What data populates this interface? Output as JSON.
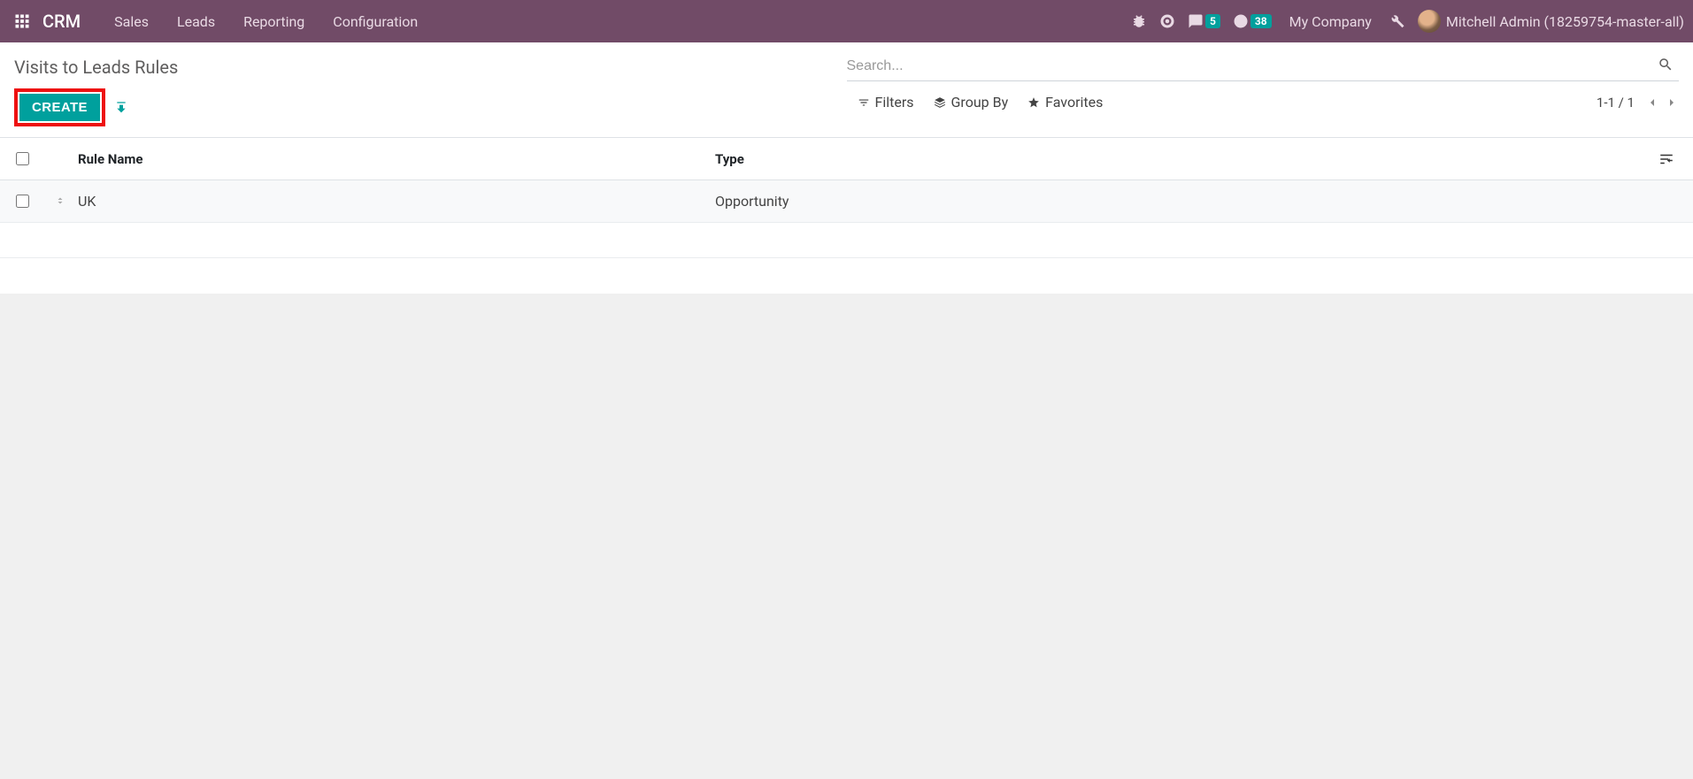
{
  "navbar": {
    "brand": "CRM",
    "menu": [
      "Sales",
      "Leads",
      "Reporting",
      "Configuration"
    ],
    "messaging_badge": "5",
    "activities_badge": "38",
    "company": "My Company",
    "user": "Mitchell Admin (18259754-master-all)"
  },
  "page": {
    "title": "Visits to Leads Rules",
    "create_label": "CREATE"
  },
  "search": {
    "placeholder": "Search..."
  },
  "toolbar": {
    "filters": "Filters",
    "group_by": "Group By",
    "favorites": "Favorites",
    "pager": "1-1 / 1"
  },
  "list": {
    "columns": {
      "rule_name": "Rule Name",
      "type": "Type"
    },
    "rows": [
      {
        "rule_name": "UK",
        "type": "Opportunity"
      }
    ]
  }
}
